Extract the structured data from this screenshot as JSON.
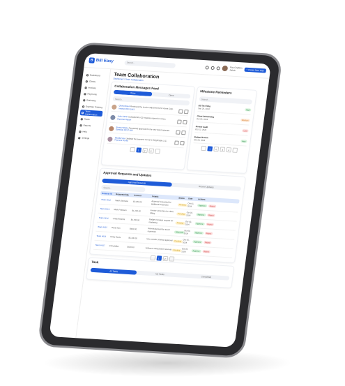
{
  "app": {
    "name": "Bill Easy",
    "logo_letter": "B"
  },
  "topbar": {
    "search_placeholder": "Search...",
    "user_name": "Ray Crighton",
    "user_role": "Admin",
    "new_task_label": "+ Create New Task"
  },
  "sidebar": {
    "items": [
      {
        "label": "Dashboard",
        "active": false
      },
      {
        "label": "Clients",
        "active": false
      },
      {
        "label": "Invoices",
        "active": false
      },
      {
        "label": "Payments",
        "active": false
      },
      {
        "label": "Estimates",
        "active": false
      },
      {
        "label": "Expense Tracking",
        "active": false
      },
      {
        "label": "Team Collaboration",
        "active": true
      },
      {
        "label": "Taxes",
        "active": false
      },
      {
        "label": "Reports",
        "active": false
      },
      {
        "label": "Help",
        "active": false
      },
      {
        "label": "Settings",
        "active": false
      }
    ]
  },
  "page": {
    "title": "Team Collaboration",
    "breadcrumb": "Dashboard / Team Collaboration"
  },
  "feed": {
    "title": "Collaboration Messages Feed",
    "tabs": [
      "Team",
      "Client"
    ],
    "search_placeholder": "Search...",
    "messages": [
      {
        "name": "Olivia Brown",
        "text": "Reviewed the invoice adjustments for Acme Corp.",
        "sub": "Invoice #INV-1043",
        "avatar": "#c9a48a"
      },
      {
        "name": "John Carter",
        "text": "Uploaded the Q3 expense report for review.",
        "sub": "Expense Report",
        "avatar": "#7c8aa8"
      },
      {
        "name": "Emma Wilson",
        "text": "Requested approval for the new client estimate.",
        "sub": "Estimate #EST-208",
        "avatar": "#b7866b"
      },
      {
        "name": "Michael Lee",
        "text": "Updated the payment terms for BrightSide LLC.",
        "sub": "Payment Terms",
        "avatar": "#a88fa0"
      }
    ],
    "pages": [
      "1",
      "2",
      "3"
    ]
  },
  "milestones": {
    "title": "Milestone Reminders",
    "search_placeholder": "Search...",
    "items": [
      {
        "title": "Q3 Tax Filing",
        "date": "Sep 30, 2024",
        "status": "High",
        "status_class": "b-green"
      },
      {
        "title": "Client Onboarding",
        "date": "Oct 05, 2024",
        "status": "Medium",
        "status_class": "b-orange"
      },
      {
        "title": "Invoice Audit",
        "date": "Oct 12, 2024",
        "status": "Low",
        "status_class": "b-red"
      },
      {
        "title": "Budget Review",
        "date": "Oct 20, 2024",
        "status": "High",
        "status_class": "b-green"
      }
    ],
    "pages": [
      "1",
      "2",
      "3",
      "4"
    ]
  },
  "approvals": {
    "title": "Approval Requests and Updates",
    "tabs": [
      "Approval Requests",
      "Recent Updates"
    ],
    "search_placeholder": "Search...",
    "columns": [
      "Request ID",
      "Requested By",
      "Amount",
      "Details",
      "Status",
      "Date",
      "Actions"
    ],
    "rows": [
      {
        "id": "Team #612",
        "by": "Sarah Johnson",
        "amount": "$2,450.00",
        "details": "Approval requested for additional expenses",
        "status": "Pending",
        "status_class": "b-yellow",
        "date": "Oct 01, 2024",
        "a1": "Approve",
        "a2": "Reject"
      },
      {
        "id": "Team #613",
        "by": "Mark Peterson",
        "amount": "$1,200.00",
        "details": "Invoice correction for client billing",
        "status": "Pending",
        "status_class": "b-yellow",
        "date": "Oct 02, 2024",
        "a1": "Approve",
        "a2": "Reject"
      },
      {
        "id": "Team #614",
        "by": "Linda Roberts",
        "amount": "$3,780.00",
        "details": "Budget increase request for marketing",
        "status": "Pending",
        "status_class": "b-yellow",
        "date": "Oct 03, 2024",
        "a1": "Approve",
        "a2": "Reject"
      },
      {
        "id": "Team #615",
        "by": "David Kim",
        "amount": "$940.00",
        "details": "Reimbursement for travel expenses",
        "status": "Approved",
        "status_class": "b-green",
        "date": "Oct 04, 2024",
        "a1": "Approve",
        "a2": "Reject"
      },
      {
        "id": "Team #616",
        "by": "Emily Davis",
        "amount": "$5,100.00",
        "details": "New vendor contract approval",
        "status": "Pending",
        "status_class": "b-yellow",
        "date": "Oct 05, 2024",
        "a1": "Approve",
        "a2": "Reject"
      },
      {
        "id": "Team #617",
        "by": "Chris Miller",
        "amount": "$620.00",
        "details": "Software subscription renewal",
        "status": "Pending",
        "status_class": "b-yellow",
        "date": "Oct 06, 2024",
        "a1": "Approve",
        "a2": "Reject"
      }
    ],
    "pages": [
      "1",
      "2"
    ]
  },
  "tasks": {
    "title": "Task",
    "tabs": [
      "All Tasks",
      "My Tasks",
      "Completed"
    ]
  }
}
